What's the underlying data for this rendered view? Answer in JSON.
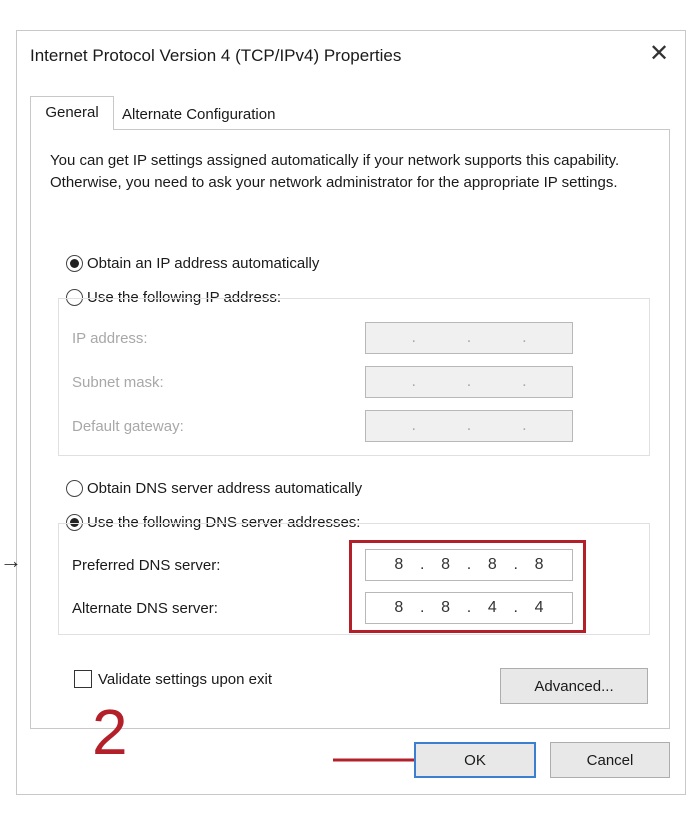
{
  "window": {
    "title": "Internet Protocol Version 4 (TCP/IPv4) Properties",
    "close_glyph": "✕"
  },
  "tabs": {
    "general": "General",
    "alternate": "Alternate Configuration"
  },
  "description": "You can get IP settings assigned automatically if your network supports this capability. Otherwise, you need to ask your network administrator for the appropriate IP settings.",
  "ip": {
    "auto_label": "Obtain an IP address automatically",
    "auto_selected": true,
    "manual_label": "Use the following IP address:",
    "fields": [
      {
        "label": "IP address:",
        "value": ""
      },
      {
        "label": "Subnet mask:",
        "value": ""
      },
      {
        "label": "Default gateway:",
        "value": ""
      }
    ]
  },
  "dns": {
    "auto_label": "Obtain DNS server address automatically",
    "manual_label": "Use the following DNS server addresses:",
    "manual_selected": true,
    "preferred_label": "Preferred DNS server:",
    "preferred_octets": [
      "8",
      "8",
      "8",
      "8"
    ],
    "alternate_label": "Alternate DNS server:",
    "alternate_octets": [
      "8",
      "8",
      "4",
      "4"
    ]
  },
  "validate_label": "Validate settings upon exit",
  "buttons": {
    "advanced": "Advanced...",
    "ok": "OK",
    "cancel": "Cancel"
  },
  "annotation": {
    "step": "2",
    "color": "#b3202a"
  },
  "colors": {
    "highlight": "#b3202a",
    "ok_border": "#3c7fd0"
  }
}
